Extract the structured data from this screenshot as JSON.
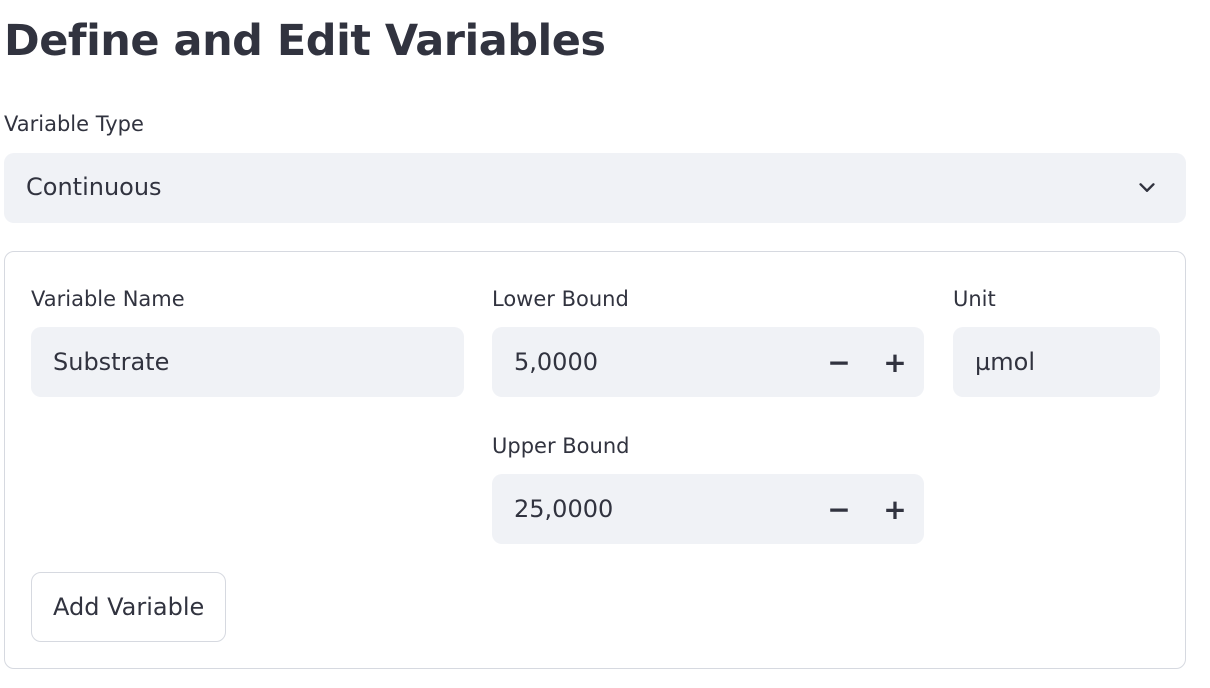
{
  "page": {
    "title": "Define and Edit Variables"
  },
  "variable_type": {
    "label": "Variable Type",
    "selected": "Continuous"
  },
  "form": {
    "variable_name": {
      "label": "Variable Name",
      "value": "Substrate"
    },
    "lower_bound": {
      "label": "Lower Bound",
      "value": "5,0000",
      "decrement": "−",
      "increment": "+"
    },
    "upper_bound": {
      "label": "Upper Bound",
      "value": "25,0000",
      "decrement": "−",
      "increment": "+"
    },
    "unit": {
      "label": "Unit",
      "value": "µmol"
    },
    "add_button_label": "Add Variable"
  },
  "icons": {
    "dropdown": "chevron-down-icon"
  },
  "colors": {
    "text": "#31333f",
    "input_background": "#f0f2f6",
    "border": "#d6d9e0"
  }
}
